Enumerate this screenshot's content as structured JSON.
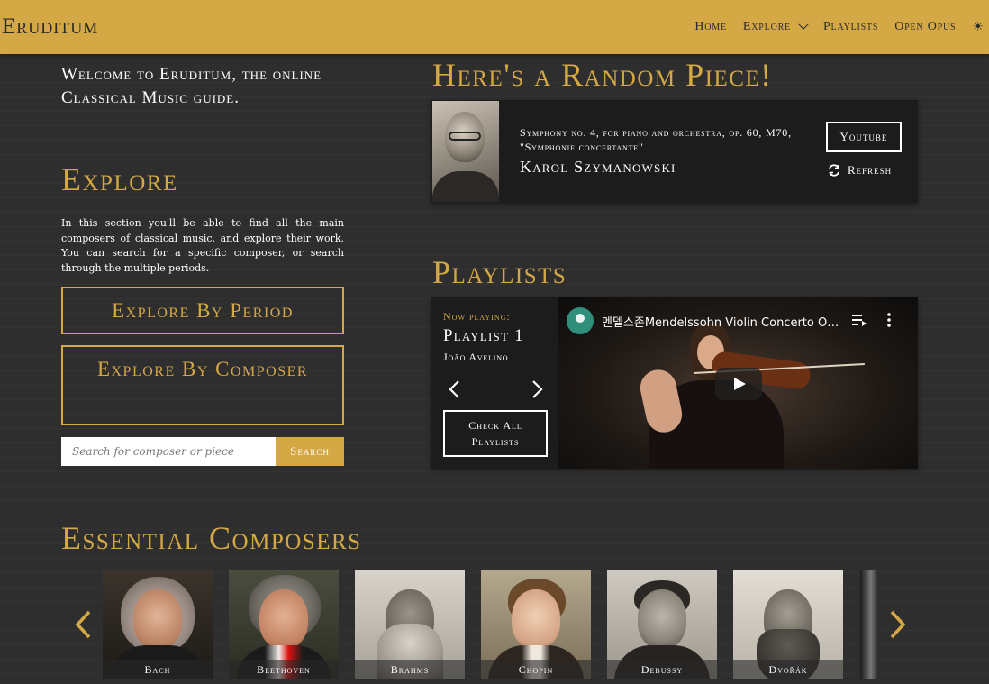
{
  "nav": {
    "brand": "Eruditum",
    "links": [
      "Home",
      "Explore",
      "Playlists",
      "Open Opus"
    ],
    "theme_icon": "sun-icon"
  },
  "welcome": "Welcome to Eruditum, the online Classical Music guide.",
  "explore": {
    "heading": "Explore",
    "description": "In this section you'll be able to find all the main composers of classical music, and explore their work. You can search for a specific composer, or search through the multiple periods.",
    "by_period": "Explore By Period",
    "by_composer": "Explore By Composer",
    "search_placeholder": "Search for composer or piece",
    "search_button": "Search"
  },
  "random_piece": {
    "heading": "Here's a Random Piece!",
    "title": "Symphony no. 4, for piano and orchestra, op. 60, M70, \"Symphonie concertante\"",
    "composer": "Karol Szymanowski",
    "youtube_button": "Youtube",
    "refresh_label": "Refresh"
  },
  "playlists": {
    "heading": "Playlists",
    "now_playing_label": "Now playing:",
    "playlist_name": "Playlist 1",
    "author": "João Avelino",
    "check_all": "Check All Playlists",
    "video_title": "멘델스존Mendelssohn Violin Concerto OP ..."
  },
  "essential": {
    "heading": "Essential Composers",
    "composers": [
      "Bach",
      "Beethoven",
      "Brahms",
      "Chopin",
      "Debussy",
      "Dvořák"
    ]
  },
  "colors": {
    "accent": "#d4a845",
    "background": "#2e2e2e",
    "card": "#1c1c1c"
  }
}
